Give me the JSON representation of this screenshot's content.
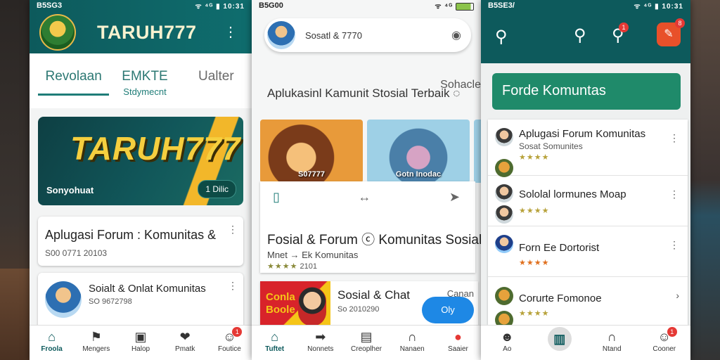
{
  "phone1": {
    "status": {
      "left": "B5SG3 ",
      "right": "ᯤ ⁴ᴳ ▮ 10:31"
    },
    "brand": "TARUH777",
    "tabs": [
      {
        "label": "Revolaan",
        "sub": ""
      },
      {
        "label": "EMKTE",
        "sub": "Stdymecnt"
      },
      {
        "label": "Ualter",
        "sub": ""
      }
    ],
    "banner": {
      "title": "TARUH777",
      "left_label": "Sonyohuat",
      "button": "1 Dilic"
    },
    "card1": {
      "title": "Aplugasi Forum : Komunitas &",
      "subtitle": "S00 0771 20103"
    },
    "card2": {
      "title": "Soialt & Onlat Komunitas",
      "subtitle": "SO 9672798"
    },
    "nav": [
      {
        "icon": "home-icon",
        "glyph": "⌂",
        "label": "Froola"
      },
      {
        "icon": "people-icon",
        "glyph": "⚑",
        "label": "Mengers"
      },
      {
        "icon": "media-icon",
        "glyph": "▣",
        "label": "Halop"
      },
      {
        "icon": "chat-icon",
        "glyph": "❤",
        "label": "Pmatk"
      },
      {
        "icon": "profile-icon",
        "glyph": "☺",
        "label": "Foutice",
        "badge": "1"
      }
    ]
  },
  "phone2": {
    "status": {
      "left": "B5G00 ",
      "right": "ᯤ ⁴ᴳ"
    },
    "search": "Sosatl & 7770",
    "heading": "Aplukasinl Kamunit Stosial Terbaik",
    "heading_right": "Sohacle",
    "thumbs": [
      {
        "caption": "S07777"
      },
      {
        "caption": "Gotn Inodac"
      }
    ],
    "card": {
      "title": "Fosial & Forum ⓒ Komunitas Sosial",
      "subtitle": "Mnet → Ek Komunitas",
      "rating_text": "2101"
    },
    "chat": {
      "tile_line1": "Conla",
      "tile_line2": "Boole",
      "title": "Sosial & Chat",
      "subtitle": "So 2010290",
      "side": "Canan",
      "fab": "Oly"
    },
    "nav": [
      {
        "icon": "home-icon",
        "glyph": "⌂",
        "label": "Tuftet"
      },
      {
        "icon": "forum-icon",
        "glyph": "➡",
        "label": "Nonnets"
      },
      {
        "icon": "library-icon",
        "glyph": "▤",
        "label": "Creoplher"
      },
      {
        "icon": "bookmark-icon",
        "glyph": "∩",
        "label": "Nanaen"
      },
      {
        "icon": "record-icon",
        "glyph": "●",
        "label": "Saaier"
      }
    ]
  },
  "phone3": {
    "status": {
      "left": "B5SE3/ ",
      "right": "ᯤ ⁴ᴳ ▮ 10:31"
    },
    "badges": {
      "search": "1",
      "edit": "8"
    },
    "forum_button": "Forde Komuntas",
    "items": [
      {
        "title": "Aplugasi Forum Komunitas",
        "subtitle": "Sosat Somunites",
        "stars": "★★★★",
        "star_color": "gold"
      },
      {
        "title": "Sololal lormunes Moap",
        "subtitle": "",
        "stars": "★★★★",
        "star_color": "gold"
      },
      {
        "title": "Forn Ee Dortorist",
        "subtitle": "",
        "stars": "★★★★",
        "star_color": "orange"
      },
      {
        "title": "Corurte Fomonoe",
        "subtitle": "",
        "stars": "★★★★",
        "star_color": "gold"
      }
    ],
    "nav": [
      {
        "icon": "user-icon",
        "glyph": "☻",
        "label": "Ao"
      },
      {
        "icon": "book-icon",
        "glyph": "▥",
        "label": ""
      },
      {
        "icon": "bookmark-icon",
        "glyph": "∩",
        "label": "Ntand"
      },
      {
        "icon": "profile-icon",
        "glyph": "☺",
        "label": "Cooner",
        "badge": "1"
      }
    ]
  }
}
